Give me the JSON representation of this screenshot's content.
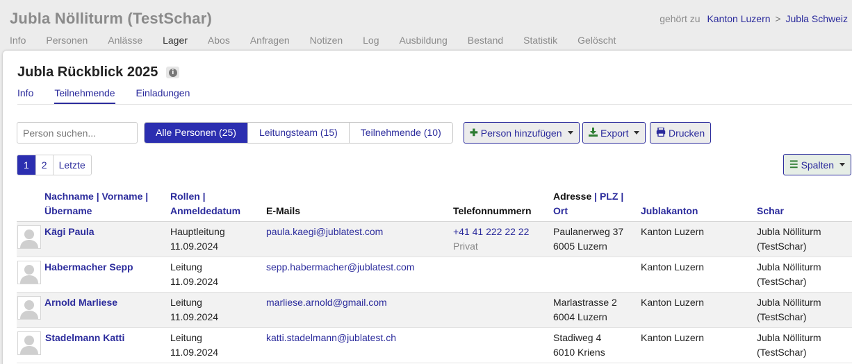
{
  "header": {
    "group_title": "Jubla Nölliturm (TestSchar)",
    "belongs_label": "gehört zu",
    "parent_1": "Kanton Luzern",
    "sep": ">",
    "parent_2": "Jubla Schweiz"
  },
  "main_nav": [
    "Info",
    "Personen",
    "Anlässe",
    "Lager",
    "Abos",
    "Anfragen",
    "Notizen",
    "Log",
    "Ausbildung",
    "Bestand",
    "Statistik",
    "Gelöscht"
  ],
  "main_nav_active": "Lager",
  "event": {
    "title": "Jubla Rückblick 2025",
    "info_glyph": "i"
  },
  "sub_nav": {
    "info": "Info",
    "participants": "Teilnehmende",
    "invitations": "Einladungen"
  },
  "search": {
    "placeholder": "Person suchen..."
  },
  "filters": {
    "all": "Alle Personen (25)",
    "leaders": "Leitungsteam (15)",
    "participants": "Teilnehmende (10)"
  },
  "actions": {
    "add_person": "Person hinzufügen",
    "export": "Export",
    "print": "Drucken",
    "columns": "Spalten"
  },
  "pager": {
    "page1": "1",
    "page2": "2",
    "last": "Letzte"
  },
  "columns": {
    "name_1": "Nachname",
    "name_2": "Vorname",
    "name_3": "Übername",
    "roles_1": "Rollen",
    "roles_2": "Anmeldedatum",
    "emails": "E-Mails",
    "phones": "Telefonnummern",
    "addr_1": "Adresse",
    "addr_2": "PLZ",
    "addr_3": "Ort",
    "canton": "Jublakanton",
    "schar": "Schar",
    "pipe": "|"
  },
  "rows": [
    {
      "name": "Kägi Paula",
      "role": "Hauptleitung",
      "date": "11.09.2024",
      "email": "paula.kaegi@jublatest.com",
      "phone": "+41 41 222 22 22",
      "phone_type": "Privat",
      "street": "Paulanerweg 37",
      "city": "6005 Luzern",
      "canton": "Kanton Luzern",
      "schar_1": "Jubla Nölliturm",
      "schar_2": "(TestSchar)"
    },
    {
      "name": "Habermacher Sepp",
      "role": "Leitung",
      "date": "11.09.2024",
      "email": "sepp.habermacher@jublatest.com",
      "phone": "",
      "phone_type": "",
      "street": "",
      "city": "",
      "canton": "Kanton Luzern",
      "schar_1": "Jubla Nölliturm",
      "schar_2": "(TestSchar)"
    },
    {
      "name": "Arnold Marliese",
      "role": "Leitung",
      "date": "11.09.2024",
      "email": "marliese.arnold@gmail.com",
      "phone": "",
      "phone_type": "",
      "street": "Marlastrasse 2",
      "city": "6004 Luzern",
      "canton": "Kanton Luzern",
      "schar_1": "Jubla Nölliturm",
      "schar_2": "(TestSchar)"
    },
    {
      "name": "Stadelmann Katti",
      "role": "Leitung",
      "date": "11.09.2024",
      "email": "katti.stadelmann@jublatest.ch",
      "phone": "",
      "phone_type": "",
      "street": "Stadiweg 4",
      "city": "6010 Kriens",
      "canton": "Kanton Luzern",
      "schar_1": "Jubla Nölliturm",
      "schar_2": "(TestSchar)"
    }
  ],
  "colors": {
    "accent": "#2b2eb0",
    "link": "#2b2b9c",
    "green_icon": "#2e7d32"
  }
}
